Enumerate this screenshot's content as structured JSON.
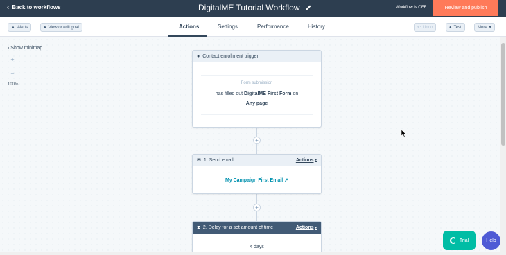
{
  "topbar": {
    "back_label": "Back to workflows",
    "title": "DigitalME Tutorial Workflow",
    "status": "Workflow is OFF",
    "review_button": "Review and publish"
  },
  "subbar": {
    "alerts": "Alerts",
    "view_goal": "View or edit goal",
    "tabs": [
      "Actions",
      "Settings",
      "Performance",
      "History"
    ],
    "active_tab": "Actions",
    "undo": "Undo",
    "test": "Test",
    "more": "More"
  },
  "canvas": {
    "show_minimap": "Show minimap",
    "zoom_level": "100%"
  },
  "trigger_card": {
    "header": "Contact enrollment trigger",
    "label": "Form submission",
    "text_prefix": "has filled out",
    "form_name": "DigitalME First Form",
    "text_on": "on",
    "page": "Any page"
  },
  "action1": {
    "header": "1. Send email",
    "actions": "Actions",
    "email_name": "My Campaign First Email"
  },
  "action2": {
    "header": "2. Delay for a set amount of time",
    "actions": "Actions",
    "delay": "4 days"
  },
  "floating": {
    "trial": "Trial",
    "help": "Help"
  },
  "colors": {
    "topbar": "#2d3e50",
    "review": "#ff7a59",
    "link": "#0091ae",
    "trial": "#00bda5",
    "help": "#4f5bd5"
  },
  "icons": [
    "chevron-left-icon",
    "pencil-icon",
    "bell-icon",
    "eye-icon",
    "user-icon",
    "email-icon",
    "hourglass-icon",
    "external-link-icon",
    "plus-icon",
    "minus-icon"
  ]
}
